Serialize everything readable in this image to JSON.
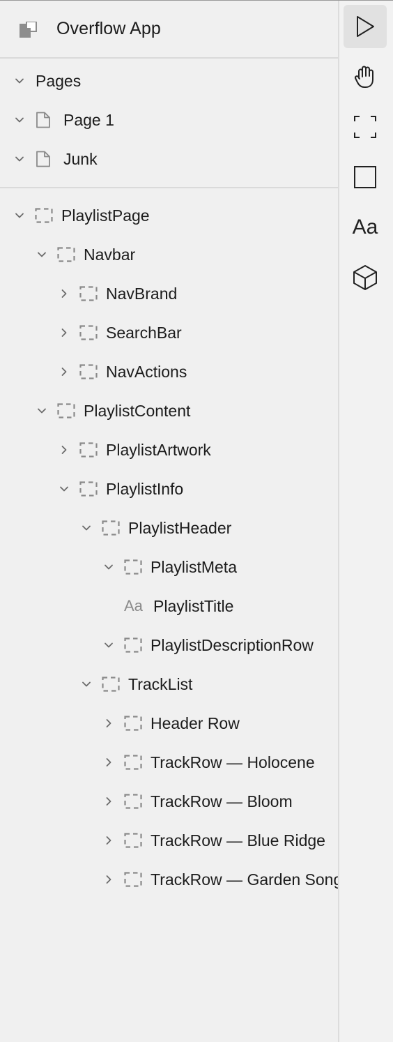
{
  "app": {
    "title": "Overflow App"
  },
  "pages": {
    "header_label": "Pages",
    "items": [
      {
        "label": "Page 1"
      },
      {
        "label": "Junk"
      }
    ]
  },
  "tree": {
    "nodes": [
      {
        "label": "PlaylistPage",
        "depth": 0,
        "expanded": true,
        "icon": "frame-icon"
      },
      {
        "label": "Navbar",
        "depth": 1,
        "expanded": true,
        "icon": "frame-icon"
      },
      {
        "label": "NavBrand",
        "depth": 2,
        "expanded": false,
        "icon": "frame-icon"
      },
      {
        "label": "SearchBar",
        "depth": 2,
        "expanded": false,
        "icon": "frame-icon"
      },
      {
        "label": "NavActions",
        "depth": 2,
        "expanded": false,
        "icon": "frame-icon"
      },
      {
        "label": "PlaylistContent",
        "depth": 1,
        "expanded": true,
        "icon": "frame-icon"
      },
      {
        "label": "PlaylistArtwork",
        "depth": 2,
        "expanded": false,
        "icon": "frame-icon"
      },
      {
        "label": "PlaylistInfo",
        "depth": 2,
        "expanded": true,
        "icon": "frame-icon"
      },
      {
        "label": "PlaylistHeader",
        "depth": 3,
        "expanded": true,
        "icon": "frame-icon"
      },
      {
        "label": "PlaylistMeta",
        "depth": 4,
        "expanded": true,
        "icon": "frame-icon"
      },
      {
        "label": "PlaylistTitle",
        "depth": 4,
        "expanded": null,
        "icon": "text-icon",
        "icon_text": "Aa"
      },
      {
        "label": "PlaylistDescriptionRow",
        "depth": 4,
        "expanded": true,
        "icon": "frame-icon"
      },
      {
        "label": "TrackList",
        "depth": 3,
        "expanded": true,
        "icon": "frame-icon"
      },
      {
        "label": "Header Row",
        "depth": 4,
        "expanded": false,
        "icon": "frame-icon"
      },
      {
        "label": "TrackRow — Holocene",
        "depth": 4,
        "expanded": false,
        "icon": "frame-icon"
      },
      {
        "label": "TrackRow — Bloom",
        "depth": 4,
        "expanded": false,
        "icon": "frame-icon"
      },
      {
        "label": "TrackRow — Blue Ridge",
        "depth": 4,
        "expanded": false,
        "icon": "frame-icon"
      },
      {
        "label": "TrackRow — Garden Song",
        "depth": 4,
        "expanded": false,
        "icon": "frame-icon"
      }
    ]
  },
  "toolbar": {
    "tools": [
      {
        "name": "select-tool",
        "icon": "pointer-icon",
        "active": true
      },
      {
        "name": "hand-tool",
        "icon": "hand-icon",
        "active": false
      },
      {
        "name": "frame-tool",
        "icon": "frame-icon",
        "active": false
      },
      {
        "name": "rectangle-tool",
        "icon": "square-icon",
        "active": false
      },
      {
        "name": "text-tool",
        "icon": "text-icon",
        "icon_text": "Aa",
        "active": false
      },
      {
        "name": "component-tool",
        "icon": "cube-icon",
        "active": false
      }
    ]
  },
  "colors": {
    "background": "#f0f0f0",
    "divider": "#dadada",
    "text": "#1c1c1c",
    "icon": "#7a7a7a",
    "active_tool_bg": "#e1e1e1"
  }
}
